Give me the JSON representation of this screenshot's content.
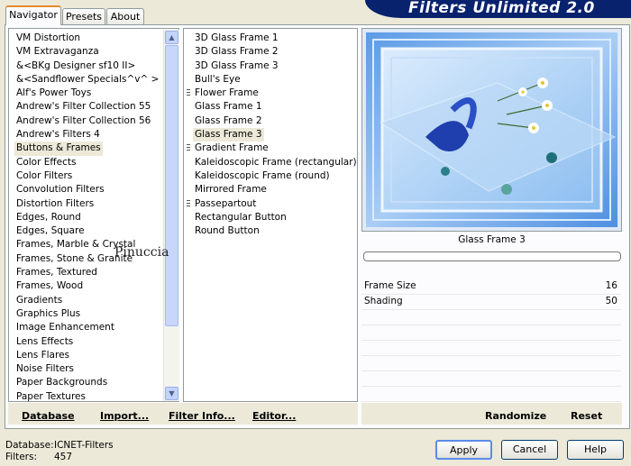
{
  "tabs": [
    "Navigator",
    "Presets",
    "About"
  ],
  "app_title": "Filters Unlimited 2.0",
  "categories": [
    "VM Distortion",
    "VM Extravaganza",
    "&<BKg Designer sf10 II>",
    "&<Sandflower Specials^v^ >",
    "Alf's Power Toys",
    "Andrew's Filter Collection 55",
    "Andrew's Filter Collection 56",
    "Andrew's Filters 4",
    "Buttons & Frames",
    "Color Effects",
    "Color Filters",
    "Convolution Filters",
    "Distortion Filters",
    "Edges, Round",
    "Edges, Square",
    "Frames, Marble & Crystal",
    "Frames, Stone & Granite",
    "Frames, Textured",
    "Frames, Wood",
    "Gradients",
    "Graphics Plus",
    "Image Enhancement",
    "Lens Effects",
    "Lens Flares",
    "Noise Filters",
    "Paper Backgrounds",
    "Paper Textures"
  ],
  "selected_category": "Buttons & Frames",
  "watermark": "Pinuccia",
  "filters": [
    {
      "label": "3D Glass Frame 1",
      "grip": false
    },
    {
      "label": "3D Glass Frame 2",
      "grip": false
    },
    {
      "label": "3D Glass Frame 3",
      "grip": false
    },
    {
      "label": "Bull's Eye",
      "grip": false
    },
    {
      "label": "Flower Frame",
      "grip": true
    },
    {
      "label": "Glass Frame 1",
      "grip": false
    },
    {
      "label": "Glass Frame 2",
      "grip": false
    },
    {
      "label": "Glass Frame 3",
      "grip": false
    },
    {
      "label": "Gradient Frame",
      "grip": true
    },
    {
      "label": "Kaleidoscopic Frame (rectangular)",
      "grip": false
    },
    {
      "label": "Kaleidoscopic Frame (round)",
      "grip": false
    },
    {
      "label": "Mirrored Frame",
      "grip": false
    },
    {
      "label": "Passepartout",
      "grip": true
    },
    {
      "label": "Rectangular Button",
      "grip": false
    },
    {
      "label": "Round Button",
      "grip": false
    }
  ],
  "selected_filter": "Glass Frame 3",
  "preview": {
    "filter_name": "Glass Frame 3",
    "progress": 0
  },
  "controls": [
    {
      "name": "Frame Size",
      "value": "16"
    },
    {
      "name": "Shading",
      "value": "50"
    }
  ],
  "bottom_bar": {
    "database": "Database",
    "import": "Import...",
    "filter_info": "Filter Info...",
    "editor": "Editor...",
    "randomize": "Randomize",
    "reset": "Reset"
  },
  "status": {
    "database_label": "Database:",
    "database_value": "ICNET-Filters",
    "filters_label": "Filters:",
    "filters_value": "457"
  },
  "buttons": {
    "apply": "Apply",
    "cancel": "Cancel",
    "help": "Help"
  },
  "colors": {
    "banner": "#08226d",
    "tab_accent": "#e68b2c",
    "selection": "#ece9d8",
    "default_button_border": "#003c74"
  }
}
